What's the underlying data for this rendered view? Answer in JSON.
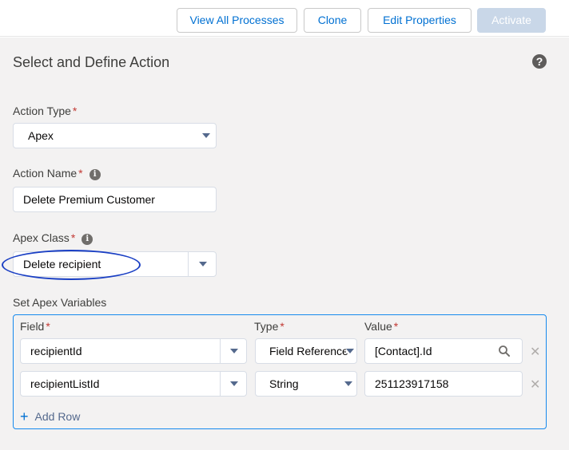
{
  "toolbar": {
    "view_all": "View All Processes",
    "clone": "Clone",
    "edit_properties": "Edit Properties",
    "activate": "Activate"
  },
  "section": {
    "title": "Select and Define Action"
  },
  "form": {
    "action_type": {
      "label": "Action Type",
      "required": "*",
      "value": "Apex"
    },
    "action_name": {
      "label": "Action Name",
      "required": "*",
      "value": "Delete Premium Customer"
    },
    "apex_class": {
      "label": "Apex Class",
      "required": "*",
      "value": "Delete recipient"
    },
    "vars_label": "Set Apex Variables"
  },
  "vars_table": {
    "headers": {
      "field": "Field",
      "type": "Type",
      "value": "Value",
      "required": "*"
    },
    "rows": [
      {
        "field": "recipientId",
        "type": "Field Reference",
        "value": "[Contact].Id"
      },
      {
        "field": "recipientListId",
        "type": "String",
        "value": "251123917158"
      }
    ],
    "add_row": "Add Row"
  },
  "icons": {
    "help": "question-circle-icon",
    "info": "info-icon",
    "search": "search-icon",
    "remove": "close-icon",
    "add": "plus-icon",
    "dropdown": "chevron-down-icon"
  },
  "colors": {
    "brand": "#0070d2",
    "required": "#c23934",
    "focus_border": "#1589ee",
    "annotation": "#1a3fc4"
  }
}
